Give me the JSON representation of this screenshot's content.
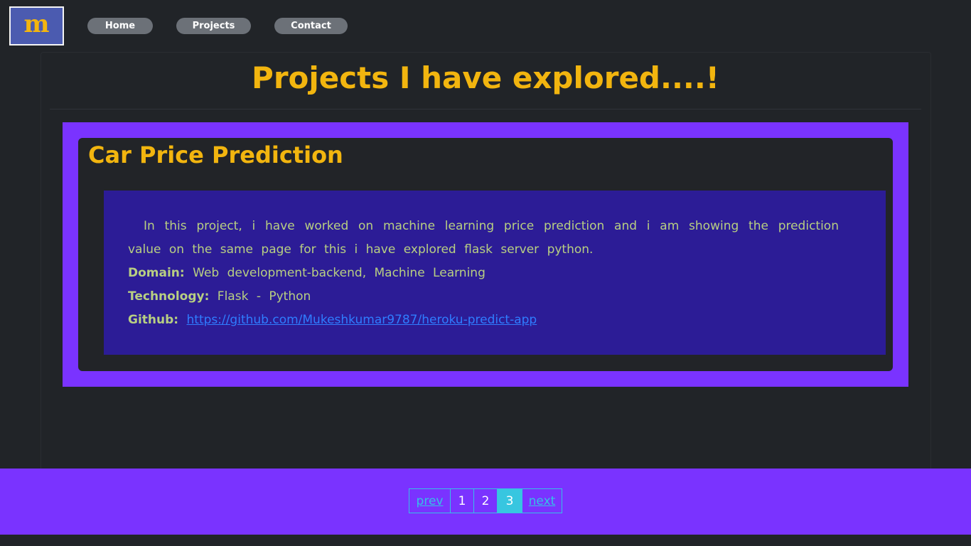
{
  "logo": {
    "text": "m"
  },
  "nav": {
    "home": "Home",
    "projects": "Projects",
    "contact": "Contact"
  },
  "page": {
    "title": "Projects I have explored....!"
  },
  "project": {
    "title": "Car Price Prediction",
    "description": "In this project, i have worked on machine learning price prediction and i am showing the prediction value on the same page for this i have explored flask server python.",
    "domain_label": "Domain:",
    "domain_value": "Web development-backend, Machine Learning",
    "technology_label": "Technology:",
    "technology_value": "Flask - Python",
    "github_label": "Github:",
    "github_link": "https://github.com/Mukeshkumar9787/heroku-predict-app"
  },
  "pagination": {
    "prev": "prev",
    "pages": [
      "1",
      "2",
      "3"
    ],
    "active_page": "3",
    "next": "next"
  },
  "colors": {
    "background": "#212428",
    "accent": "#f2b50f",
    "frame": "#7a33ff",
    "desc_box": "#2c1c96",
    "desc_text": "#b8cf82",
    "link": "#2f7dff",
    "pager_active": "#37c6e0"
  }
}
